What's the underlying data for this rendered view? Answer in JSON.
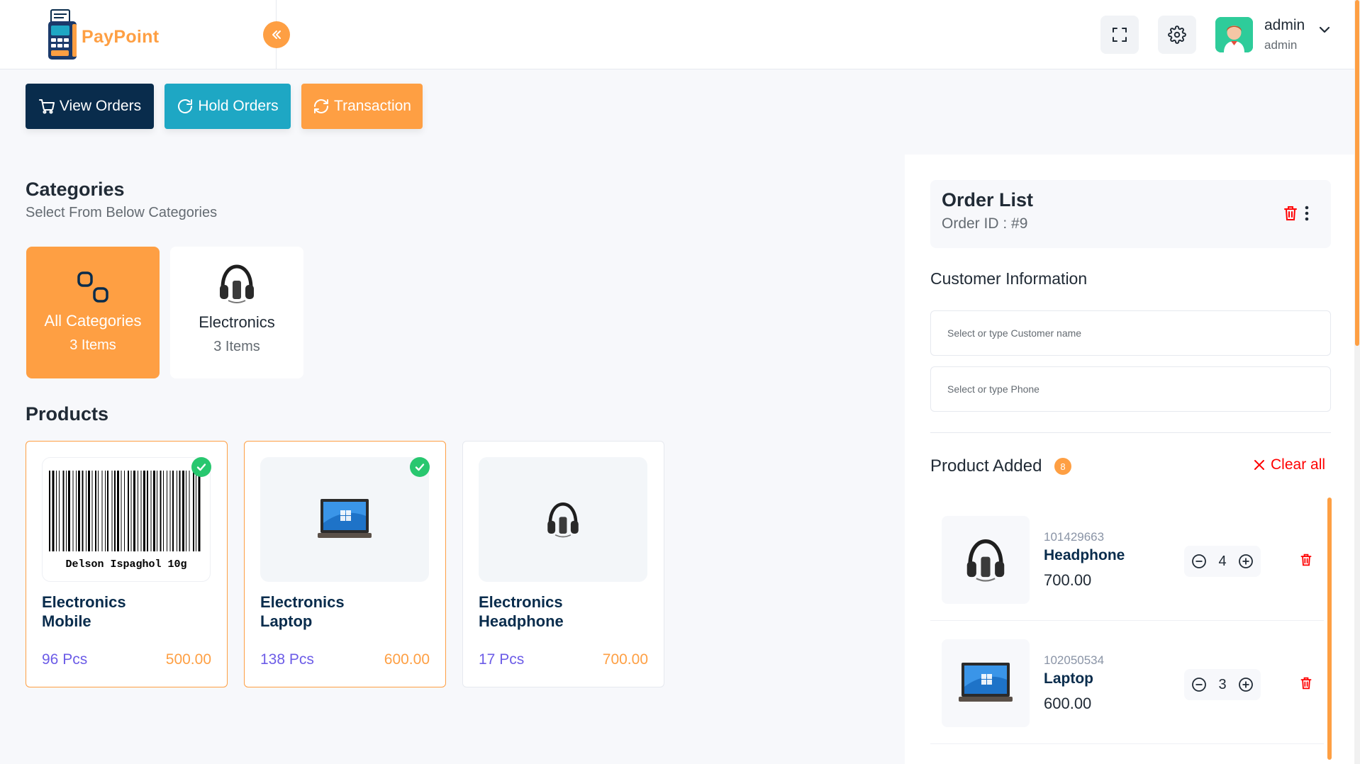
{
  "app": {
    "logo_text": "PayPoint",
    "user": {
      "name": "admin",
      "role": "admin"
    }
  },
  "actions": {
    "view_orders": "View Orders",
    "hold_orders": "Hold Orders",
    "transaction": "Transaction"
  },
  "categories": {
    "title": "Categories",
    "subtitle": "Select From Below Categories",
    "items": [
      {
        "name": "All Categories",
        "count": "3 Items",
        "active": true,
        "icon": "categories-icon"
      },
      {
        "name": "Electronics",
        "count": "3 Items",
        "active": false,
        "icon": "headphone-icon"
      }
    ]
  },
  "products": {
    "title": "Products",
    "items": [
      {
        "category": "Electronics",
        "name": "Mobile",
        "qty": "96 Pcs",
        "price": "500.00",
        "selected": true,
        "image": "barcode-image",
        "barcode_caption": "Delson Ispaghol 10g"
      },
      {
        "category": "Electronics",
        "name": "Laptop",
        "qty": "138 Pcs",
        "price": "600.00",
        "selected": true,
        "image": "laptop-image"
      },
      {
        "category": "Electronics",
        "name": "Headphone",
        "qty": "17 Pcs",
        "price": "700.00",
        "selected": false,
        "image": "headphone-image"
      }
    ]
  },
  "order": {
    "title": "Order List",
    "order_id": "Order ID : #9",
    "customer_info_title": "Customer Information",
    "customer_placeholder": "Select or type Customer name",
    "phone_placeholder": "Select or type Phone",
    "product_added_title": "Product Added",
    "product_added_count": "8",
    "clear_all": "Clear all",
    "items": [
      {
        "sku": "101429663",
        "name": "Headphone",
        "price": "700.00",
        "qty": "4",
        "image": "headphone-image"
      },
      {
        "sku": "102050534",
        "name": "Laptop",
        "price": "600.00",
        "qty": "3",
        "image": "laptop-image"
      }
    ]
  },
  "colors": {
    "primary": "#fe9f43",
    "dark": "#092c4c",
    "teal": "#1ea7c4",
    "success": "#28c76f",
    "danger": "#ff0000",
    "purple": "#6c5ce7"
  }
}
